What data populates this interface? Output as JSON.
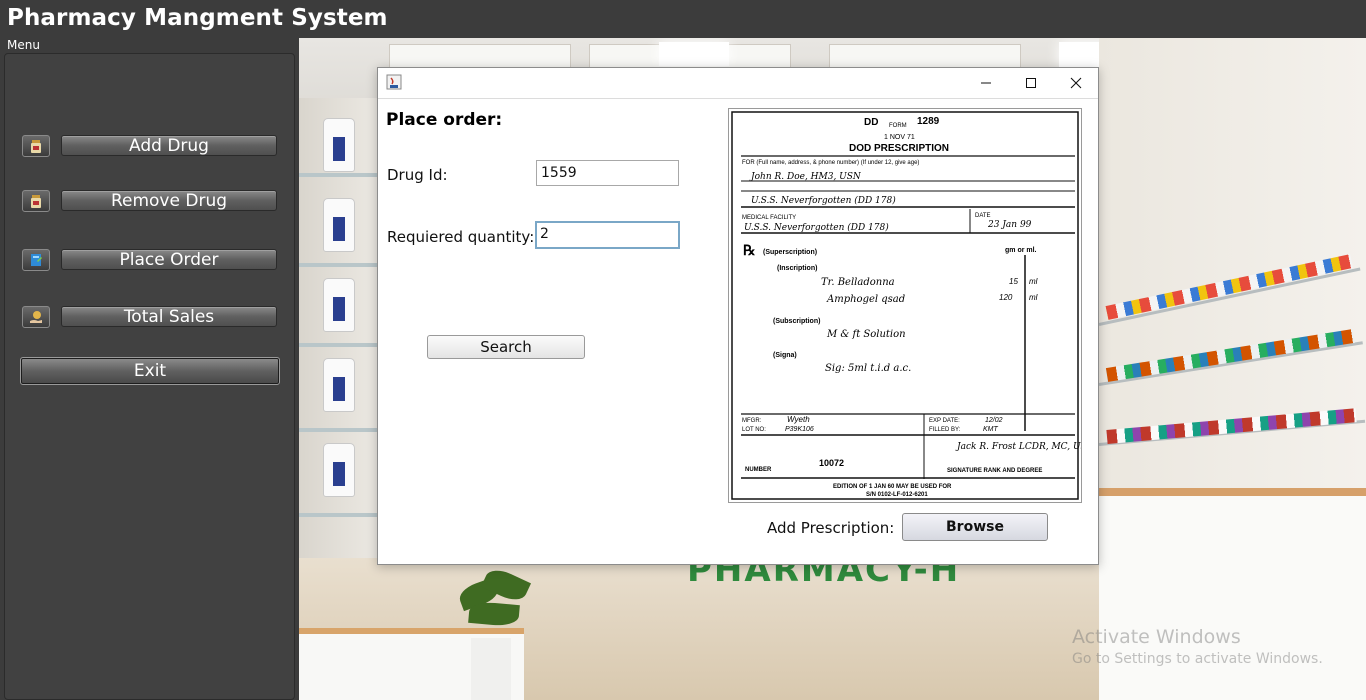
{
  "app": {
    "title": "Pharmacy Mangment System",
    "menu_label": "Menu"
  },
  "sidebar": {
    "items": [
      {
        "label": "Add Drug",
        "icon": "medicine-bottle-icon"
      },
      {
        "label": "Remove Drug",
        "icon": "medicine-bottle-icon"
      },
      {
        "label": "Place Order",
        "icon": "order-book-icon"
      },
      {
        "label": "Total Sales",
        "icon": "money-hand-icon"
      }
    ],
    "exit_label": "Exit"
  },
  "background": {
    "sign": "PHARMACY-H",
    "watermark_title": "Activate Windows",
    "watermark_sub": "Go to Settings to activate Windows."
  },
  "dialog": {
    "heading": "Place order:",
    "drug_id_label": "Drug Id:",
    "drug_id_value": "1559",
    "quantity_label": "Requiered quantity:",
    "quantity_value": "2",
    "search_label": "Search",
    "prescription_label": "Add Prescription:",
    "browse_label": "Browse",
    "prescription": {
      "form_code": "DD",
      "form_word": "FORM",
      "form_number": "1289",
      "form_date": "1 NOV 71",
      "title": "DOD PRESCRIPTION",
      "for_label": "FOR (Full name, address, & phone number) (If under 12, give age)",
      "patient_name": "John R. Doe, HM3, USN",
      "patient_addr": "U.S.S. Neverforgotten (DD 178)",
      "facility_label": "MEDICAL FACILITY",
      "facility": "U.S.S. Neverforgotten (DD 178)",
      "date_label": "DATE",
      "date": "23 Jan 99",
      "rx_symbol": "℞",
      "superscription": "(Superscription)",
      "units": "gm or ml.",
      "inscription": "(Inscription)",
      "line1": "Tr. Belladonna",
      "line1_qty": "15",
      "line1_unit": "ml",
      "line2": "Amphogel qsad",
      "line2_qty": "120",
      "line2_unit": "ml",
      "subscription": "(Subscription)",
      "sub_text": "M & ft Solution",
      "signa": "(Signa)",
      "signa_text": "Sig: 5ml t.i.d a.c.",
      "mfgr_label": "MFGR:",
      "mfgr": "Wyeth",
      "lot_label": "LOT NO:",
      "lot": "P39K106",
      "exp_label": "EXP DATE:",
      "exp": "12/02",
      "filled_label": "FILLED BY:",
      "filled": "KMT",
      "rx_number_label": "NUMBER",
      "rx_number": "10072",
      "signature": "Jack R. Frost LCDR, MC, USNR",
      "signature_label": "SIGNATURE RANK AND DEGREE",
      "edition": "EDITION OF 1 JAN 60 MAY BE USED FOR",
      "sn": "S/N 0102-LF-012-6201"
    }
  }
}
